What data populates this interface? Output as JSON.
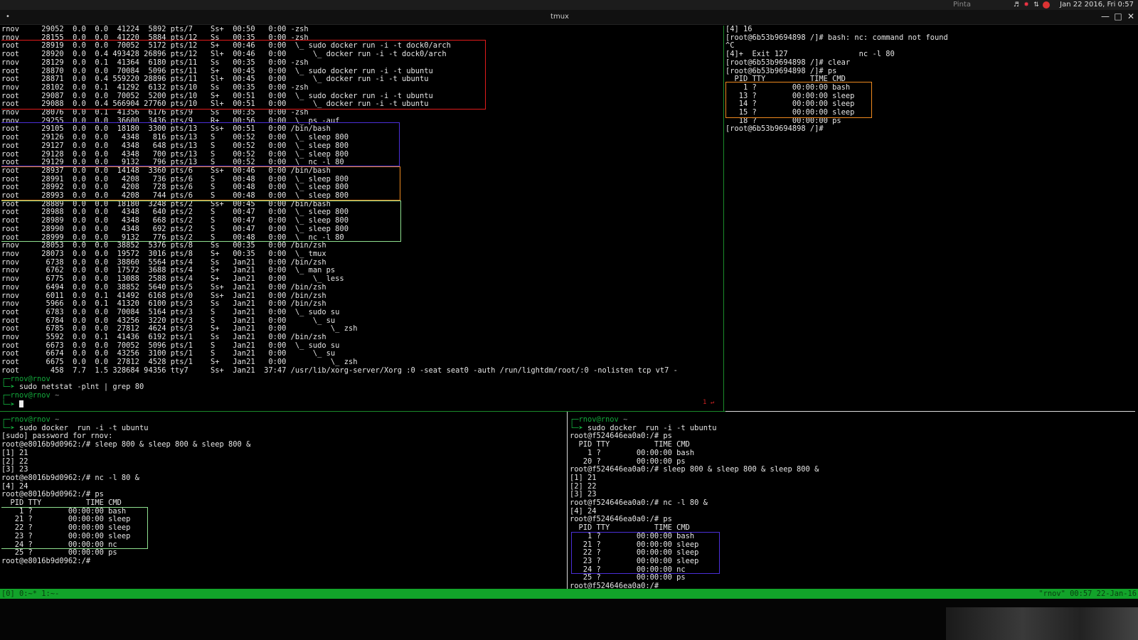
{
  "topbar": {
    "app_name": "Pinta",
    "clock": "Jan 22 2016, Fri 0:57",
    "tray_icons": [
      "volume-icon",
      "bug-icon",
      "network-icon",
      "record-icon"
    ]
  },
  "window": {
    "title": "tmux",
    "menu_dot": "•"
  },
  "pane_main": {
    "ps_lines": [
      "rnov     29052  0.0  0.0  41224  5892 pts/7    Ss+  00:50   0:00 -zsh",
      "rnov     28155  0.0  0.0  41220  5884 pts/12   Ss   00:35   0:00 -zsh",
      "root     28919  0.0  0.0  70052  5172 pts/12   S+   00:46   0:00  \\_ sudo docker run -i -t dock0/arch",
      "root     28920  0.0  0.4 493428 26896 pts/12   Sl+  00:46   0:00      \\_ docker run -i -t dock0/arch",
      "rnov     28129  0.0  0.1  41364  6180 pts/11   Ss   00:35   0:00 -zsh",
      "root     28870  0.0  0.0  70084  5096 pts/11   S+   00:45   0:00  \\_ sudo docker run -i -t ubuntu",
      "root     28871  0.0  0.4 559220 28896 pts/11   Sl+  00:45   0:00      \\_ docker run -i -t ubuntu",
      "rnov     28102  0.0  0.1  41292  6132 pts/10   Ss   00:35   0:00 -zsh",
      "root     29087  0.0  0.0  70052  5200 pts/10   S+   00:51   0:00  \\_ sudo docker run -i -t ubuntu",
      "root     29088  0.0  0.4 566904 27760 pts/10   Sl+  00:51   0:00      \\_ docker run -i -t ubuntu",
      "rnov     28076  0.0  0.1  41356  6176 pts/9    Ss   00:35   0:00 -zsh",
      "rnov     29255  0.0  0.0  36600  3436 pts/9    R+   00:56   0:00  \\_ ps -auf",
      "root     29105  0.0  0.0  18180  3300 pts/13   Ss+  00:51   0:00 /bin/bash",
      "root     29126  0.0  0.0   4348   816 pts/13   S    00:52   0:00  \\_ sleep 800",
      "root     29127  0.0  0.0   4348   648 pts/13   S    00:52   0:00  \\_ sleep 800",
      "root     29128  0.0  0.0   4348   700 pts/13   S    00:52   0:00  \\_ sleep 800",
      "root     29129  0.0  0.0   9132   796 pts/13   S    00:52   0:00  \\_ nc -l 80",
      "root     28937  0.0  0.0  14148  3360 pts/6    Ss+  00:46   0:00 /bin/bash",
      "root     28991  0.0  0.0   4208   736 pts/6    S    00:48   0:00  \\_ sleep 800",
      "root     28992  0.0  0.0   4208   728 pts/6    S    00:48   0:00  \\_ sleep 800",
      "root     28993  0.0  0.0   4208   744 pts/6    S    00:48   0:00  \\_ sleep 800",
      "root     28889  0.0  0.0  18180  3248 pts/2    Ss+  00:45   0:00 /bin/bash",
      "root     28988  0.0  0.0   4348   640 pts/2    S    00:47   0:00  \\_ sleep 800",
      "root     28989  0.0  0.0   4348   668 pts/2    S    00:47   0:00  \\_ sleep 800",
      "root     28990  0.0  0.0   4348   692 pts/2    S    00:47   0:00  \\_ sleep 800",
      "root     28999  0.0  0.0   9132   776 pts/2    S    00:48   0:00  \\_ nc -l 80",
      "rnov     28053  0.0  0.0  38852  5376 pts/8    Ss   00:35   0:00 /bin/zsh",
      "rnov     28073  0.0  0.0  19572  3016 pts/8    S+   00:35   0:00  \\_ tmux",
      "rnov      6738  0.0  0.0  38860  5564 pts/4    Ss   Jan21   0:00 /bin/zsh",
      "rnov      6762  0.0  0.0  17572  3688 pts/4    S+   Jan21   0:00  \\_ man ps",
      "rnov      6775  0.0  0.0  13088  2588 pts/4    S+   Jan21   0:00      \\_ less",
      "rnov      6494  0.0  0.0  38852  5640 pts/5    Ss+  Jan21   0:00 /bin/zsh",
      "rnov      6011  0.0  0.1  41492  6168 pts/0    Ss+  Jan21   0:00 /bin/zsh",
      "rnov      5966  0.0  0.1  41320  6100 pts/3    Ss   Jan21   0:00 /bin/zsh",
      "root      6783  0.0  0.0  70084  5164 pts/3    S    Jan21   0:00  \\_ sudo su",
      "root      6784  0.0  0.0  43256  3220 pts/3    S    Jan21   0:00      \\_ su",
      "root      6785  0.0  0.0  27812  4624 pts/3    S+   Jan21   0:00          \\_ zsh",
      "rnov      5592  0.0  0.1  41436  6192 pts/1    Ss   Jan21   0:00 /bin/zsh",
      "root      6673  0.0  0.0  70052  5096 pts/1    S    Jan21   0:00  \\_ sudo su",
      "root      6674  0.0  0.0  43256  3100 pts/1    S    Jan21   0:00      \\_ su",
      "root      6675  0.0  0.0  27812  4528 pts/1    S+   Jan21   0:00          \\_ zsh",
      "root       458  7.7  1.5 328684 94356 tty7     Ss+  Jan21  37:47 /usr/lib/xorg-server/Xorg :0 -seat seat0 -auth /run/lightdm/root/:0 -nolisten tcp vt7 -"
    ],
    "prompt1_user": "rnov@rnov",
    "cmd1": "sudo netstat -plnt | grep 80",
    "prompt2_user": "rnov@rnov",
    "tilde": "~",
    "right_mark": "1 ↵"
  },
  "pane_topright": {
    "lines": [
      "[4] 16",
      "[root@6b53b9694898 /]# bash: nc: command not found",
      "^C",
      "[4]+  Exit 127                nc -l 80",
      "[root@6b53b9694898 /]# clear",
      "[root@6b53b9694898 /]# ps",
      "  PID TTY          TIME CMD",
      "    1 ?        00:00:00 bash",
      "   13 ?        00:00:00 sleep",
      "   14 ?        00:00:00 sleep",
      "   15 ?        00:00:00 sleep",
      "   18 ?        00:00:00 ps",
      "[root@6b53b9694898 /]#"
    ]
  },
  "pane_bottomleft": {
    "prompt_user": "rnov@rnov",
    "tilde": "~",
    "cmd": "sudo docker  run -i -t ubuntu",
    "lines": [
      "[sudo] password for rnov:",
      "root@e8016b9d0962:/# sleep 800 & sleep 800 & sleep 800 &",
      "[1] 21",
      "[2] 22",
      "[3] 23",
      "root@e8016b9d0962:/# nc -l 80 &",
      "[4] 24",
      "root@e8016b9d0962:/# ps",
      "  PID TTY          TIME CMD",
      "    1 ?        00:00:00 bash",
      "   21 ?        00:00:00 sleep",
      "   22 ?        00:00:00 sleep",
      "   23 ?        00:00:00 sleep",
      "   24 ?        00:00:00 nc",
      "   25 ?        00:00:00 ps",
      "root@e8016b9d0962:/#"
    ]
  },
  "pane_bottomright": {
    "prompt_user": "rnov@rnov",
    "tilde": "~",
    "cmd": "sudo docker  run -i -t ubuntu",
    "lines": [
      "root@f524646ea0a0:/# ps",
      "  PID TTY          TIME CMD",
      "    1 ?        00:00:00 bash",
      "   20 ?        00:00:00 ps",
      "root@f524646ea0a0:/# sleep 800 & sleep 800 & sleep 800 &",
      "[1] 21",
      "[2] 22",
      "[3] 23",
      "root@f524646ea0a0:/# nc -l 80 &",
      "[4] 24",
      "root@f524646ea0a0:/# ps",
      "  PID TTY          TIME CMD",
      "    1 ?        00:00:00 bash",
      "   21 ?        00:00:00 sleep",
      "   22 ?        00:00:00 sleep",
      "   23 ?        00:00:00 sleep",
      "   24 ?        00:00:00 nc",
      "   25 ?        00:00:00 ps",
      "root@f524646ea0a0:/#"
    ]
  },
  "statusbar": {
    "left": "[0] 0:~* 1:~-",
    "right": "\"rnov\" 00:57 22-Jan-16"
  },
  "colors": {
    "red": "#e11b1b",
    "purple": "#4b2fd8",
    "orange": "#ef8a1f",
    "green": "#8fe08f",
    "status_green": "#12a32a"
  }
}
